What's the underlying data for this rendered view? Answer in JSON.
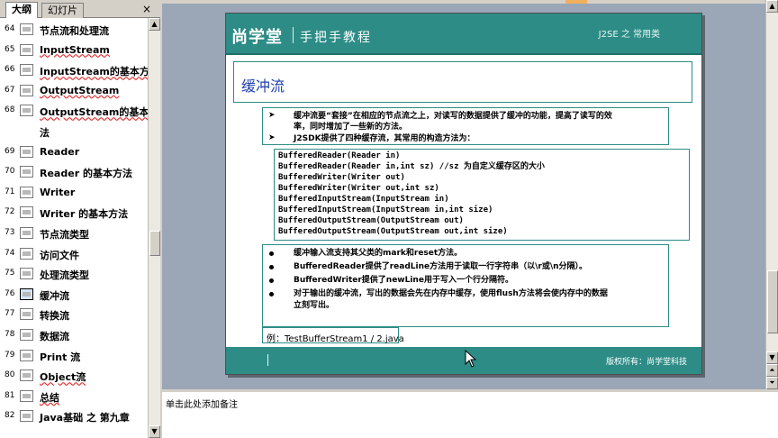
{
  "outline_pane": {
    "tabs": [
      "大纲",
      "幻灯片"
    ],
    "close_glyph": "×",
    "items": [
      {
        "num": "64",
        "label": "节点流和处理流",
        "link": false
      },
      {
        "num": "65",
        "label": "InputStream",
        "link": true
      },
      {
        "num": "66",
        "label": "InputStream的基本方法",
        "link": true
      },
      {
        "num": "67",
        "label": "OutputStream",
        "link": true
      },
      {
        "num": "68",
        "label": "OutputStream的基本方",
        "link": true
      },
      {
        "num": "",
        "label": "法",
        "link": false
      },
      {
        "num": "69",
        "label": "Reader",
        "link": false
      },
      {
        "num": "70",
        "label": "Reader 的基本方法",
        "link": false
      },
      {
        "num": "71",
        "label": "Writer",
        "link": false
      },
      {
        "num": "72",
        "label": "Writer 的基本方法",
        "link": false
      },
      {
        "num": "73",
        "label": "节点流类型",
        "link": false
      },
      {
        "num": "74",
        "label": "访问文件",
        "link": false
      },
      {
        "num": "75",
        "label": "处理流类型",
        "link": false
      },
      {
        "num": "76",
        "label": "缓冲流",
        "link": false,
        "selected": true
      },
      {
        "num": "77",
        "label": "转换流",
        "link": false
      },
      {
        "num": "78",
        "label": "数据流",
        "link": false
      },
      {
        "num": "79",
        "label": "Print 流",
        "link": false
      },
      {
        "num": "80",
        "label": "Object流",
        "link": true
      },
      {
        "num": "81",
        "label": "总结",
        "link": true
      },
      {
        "num": "82",
        "label": "Java基础 之 第九章",
        "link": false
      }
    ]
  },
  "slide": {
    "logo": "尚学堂",
    "tagline": "手把手教程",
    "header_right": "J2SE 之 常用类",
    "title": "缓冲流",
    "intro_lines": [
      "缓冲流要“套接”在相应的节点流之上，对读写的数据提供了缓冲的功能，提高了读写的效",
      "率，同时增加了一些新的方法。",
      "J2SDK提供了四种缓存流，其常用的构造方法为："
    ],
    "arrow_glyph": "➤",
    "code_lines": [
      "BufferedReader(Reader in)",
      "BufferedReader(Reader in,int sz) //sz 为自定义缓存区的大小",
      "BufferedWriter(Writer out)",
      "BufferedWriter(Writer out,int sz)",
      "BufferedInputStream(InputStream in)",
      "BufferedInputStream(InputStream in,int size)",
      "BufferedOutputStream(OutputStream out)",
      "BufferedOutputStream(OutputStream out,int size)"
    ],
    "notes": [
      "缓冲输入流支持其父类的mark和reset方法。",
      "BufferedReader提供了readLine方法用于读取一行字符串（以\\r或\\n分隔）。",
      "BufferedWriter提供了newLine用于写入一个行分隔符。",
      "对于输出的缓冲流，写出的数据会先在内存中缓存，使用flush方法将会使内存中的数据",
      "立刻写出。"
    ],
    "example": "例：TestBufferStream1 / 2.java",
    "footer_mark": "|",
    "copyright": "版权所有：尚学堂科技"
  },
  "notes_pane": {
    "placeholder": "单击此处添加备注"
  },
  "colors": {
    "teal": "#2d8c86",
    "title_blue": "#1f3fae",
    "workspace": "#9ba7b6"
  }
}
